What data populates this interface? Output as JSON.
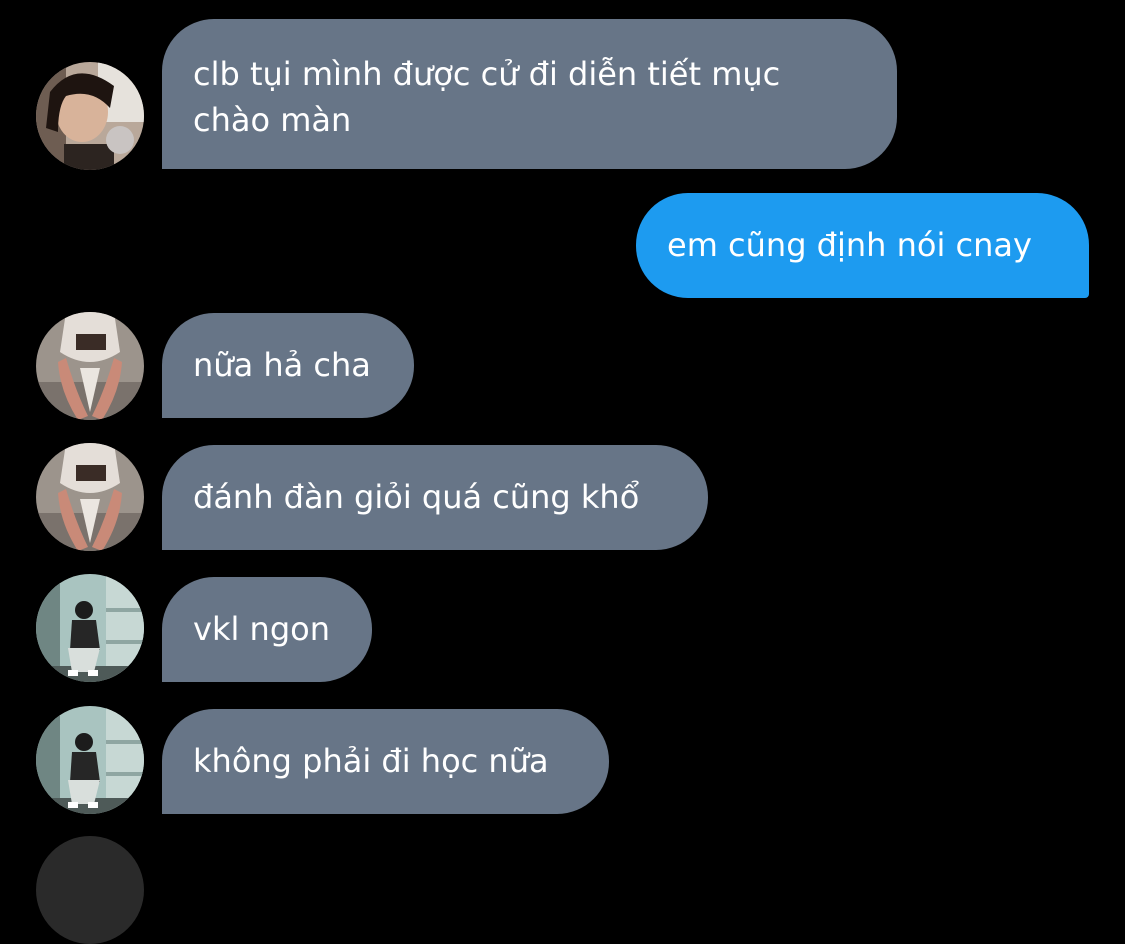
{
  "colors": {
    "background": "#000000",
    "incoming_bubble": "#677587",
    "outgoing_bubble": "#1d9bf0",
    "text": "#ffffff"
  },
  "messages": [
    {
      "direction": "incoming",
      "avatar": "avatar-girl-photo-icon",
      "text_lines": [
        "clb tụi mình được cử đi diễn tiết mục",
        "chào màn"
      ]
    },
    {
      "direction": "outgoing",
      "text": "em cũng định nói cnay"
    },
    {
      "direction": "incoming",
      "avatar": "avatar-masked-person-photo-icon",
      "text": "nữa hả cha"
    },
    {
      "direction": "incoming",
      "avatar": "avatar-masked-person-photo-icon",
      "text": "đánh đàn giỏi quá cũng khổ"
    },
    {
      "direction": "incoming",
      "avatar": "avatar-seated-person-photo-icon",
      "text": "vkl ngon"
    },
    {
      "direction": "incoming",
      "avatar": "avatar-seated-person-photo-icon",
      "text": "không phải đi học nữa"
    }
  ]
}
